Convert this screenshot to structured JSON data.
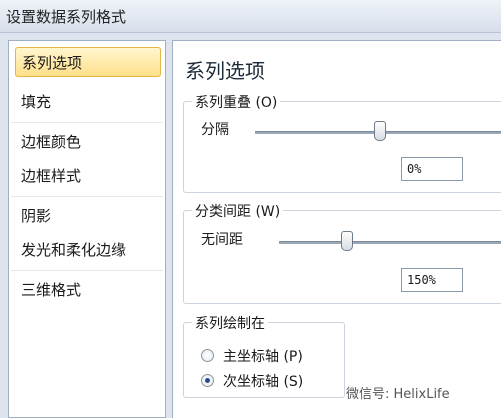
{
  "window": {
    "title": "设置数据系列格式"
  },
  "sidebar": {
    "items": [
      {
        "label": "系列选项",
        "selected": true
      },
      {
        "label": "填充"
      },
      {
        "label": "边框颜色"
      },
      {
        "label": "边框样式"
      },
      {
        "label": "阴影"
      },
      {
        "label": "发光和柔化边缘"
      },
      {
        "label": "三维格式"
      }
    ]
  },
  "main": {
    "heading": "系列选项",
    "overlap": {
      "label": "系列重叠 (O)",
      "left_label": "分隔",
      "value": "0%",
      "slider_fraction": 0.5
    },
    "gap_width": {
      "label": "分类间距 (W)",
      "left_label": "无间距",
      "value": "150%",
      "slider_fraction": 0.3
    },
    "plot_on": {
      "label": "系列绘制在",
      "options": [
        {
          "label": "主坐标轴 (P)",
          "checked": false
        },
        {
          "label": "次坐标轴 (S)",
          "checked": true
        }
      ]
    }
  },
  "watermark": "微信号: HelixLife"
}
